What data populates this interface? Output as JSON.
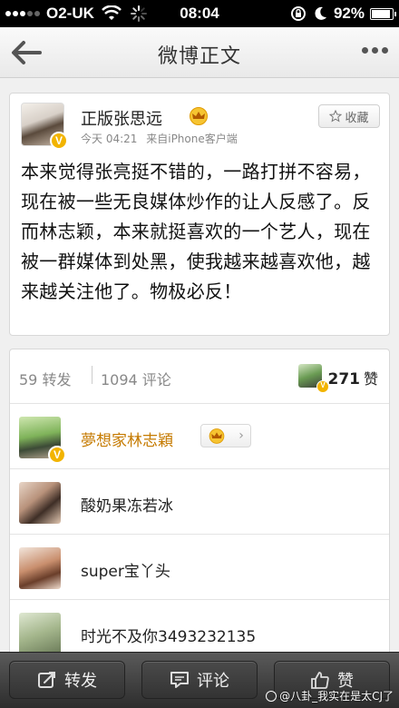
{
  "status_bar": {
    "carrier": "O2-UK",
    "time": "08:04",
    "battery": "92%",
    "battery_level": 0.92
  },
  "nav": {
    "title": "微博正文",
    "back_icon": "back-arrow-icon",
    "more_icon": "more-dots-icon"
  },
  "post": {
    "author": "正版张思远",
    "time": "今天 04:21",
    "source": "来自iPhone客户端",
    "favorite_label": "收藏",
    "text": "本来觉得张亮挺不错的，一路打拼不容易，现在被一些无良媒体炒作的让人反感了。反而林志颖，本来就挺喜欢的一个艺人，现在被一群媒体到处黑，使我越来越喜欢他，越来越关注他了。物极必反！"
  },
  "stats": {
    "reposts": "59 转发",
    "comments": "1094 评论",
    "likes_count": "271",
    "likes_label": "赞"
  },
  "likers": [
    {
      "name": "夢想家林志穎",
      "verified": true,
      "vip": true
    },
    {
      "name": "酸奶果冻若冰"
    },
    {
      "name": "super宝丫头"
    },
    {
      "name": "时光不及你3493232135"
    }
  ],
  "toolbar": {
    "repost_label": "转发",
    "comment_label": "评论",
    "like_label": "赞"
  },
  "watermark": "@八卦_我实在是太CJ了",
  "colors": {
    "vip_gold": "#f2b400",
    "name_gold": "#c57a00",
    "toolbar_dark": "#333333"
  }
}
